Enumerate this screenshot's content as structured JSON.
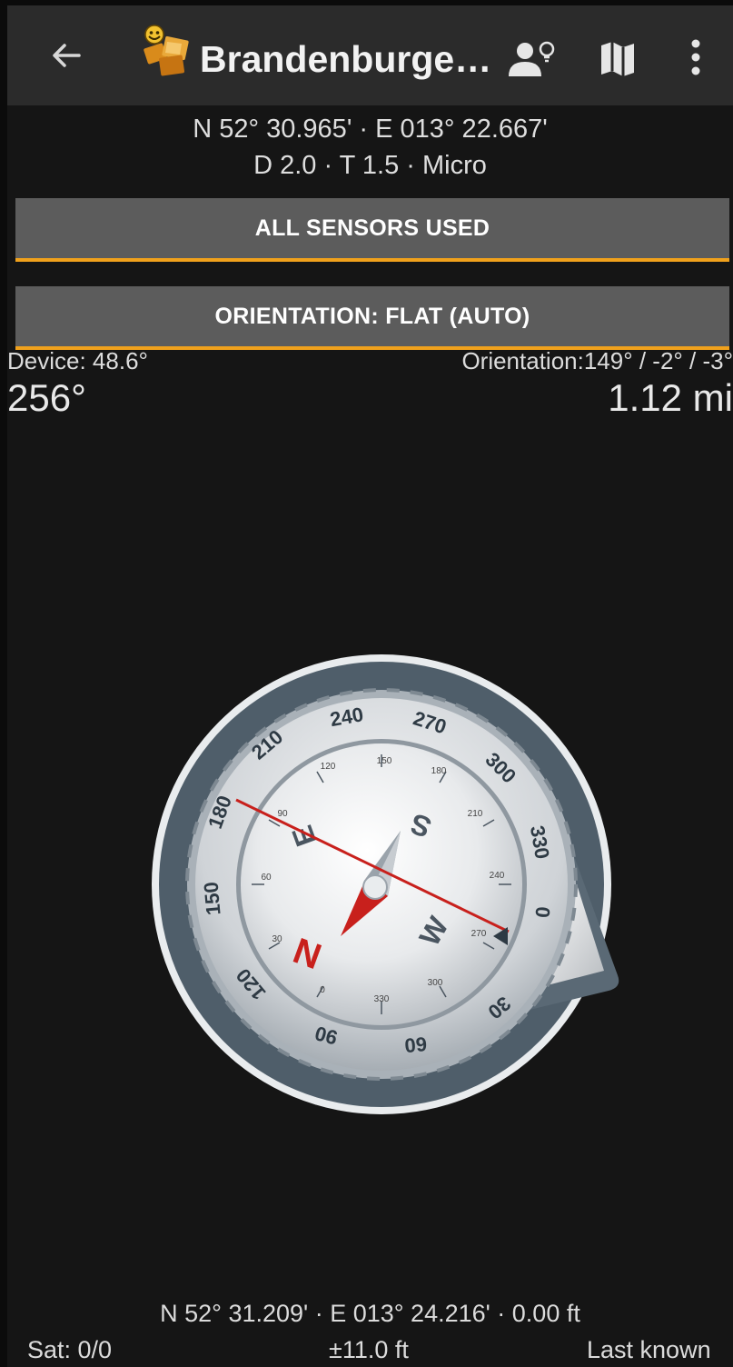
{
  "toolbar": {
    "back_icon": "arrow-back-icon",
    "logo_icon": "geocache-logo-icon",
    "title": "Brandenburge…",
    "hint_icon": "person-hint-icon",
    "map_icon": "map-icon",
    "more_icon": "more-vert-icon"
  },
  "target": {
    "coords": "N 52° 30.965' · E 013° 22.667'",
    "details": "D 2.0 · T 1.5 · Micro"
  },
  "buttons": {
    "sensors": "ALL SENSORS USED",
    "orientation": "ORIENTATION: FLAT (AUTO)"
  },
  "colors": {
    "accent": "#f0a11c",
    "background": "#151515",
    "toolbar": "#2b2b2b",
    "button": "#5c5c5c"
  },
  "readout": {
    "device": "Device:  48.6°",
    "orientation": "Orientation:149° /  -2° /  -3°",
    "heading": "256°",
    "distance": "1.12 mi"
  },
  "compass": {
    "outer_ticks": [
      "240",
      "270",
      "300",
      "330",
      "0",
      "30",
      "60",
      "90",
      "120",
      "150",
      "180",
      "210"
    ],
    "inner_ticks": [
      "120",
      "150",
      "180",
      "210",
      "240",
      "270",
      "300",
      "330",
      "0",
      "30",
      "60",
      "90"
    ],
    "cardinals": [
      "N",
      "E",
      "S",
      "W"
    ]
  },
  "status": {
    "position": "N 52° 31.209' · E 013° 24.216' · 0.00 ft",
    "satellites": "Sat: 0/0",
    "accuracy": "±11.0 ft",
    "source": "Last known"
  }
}
